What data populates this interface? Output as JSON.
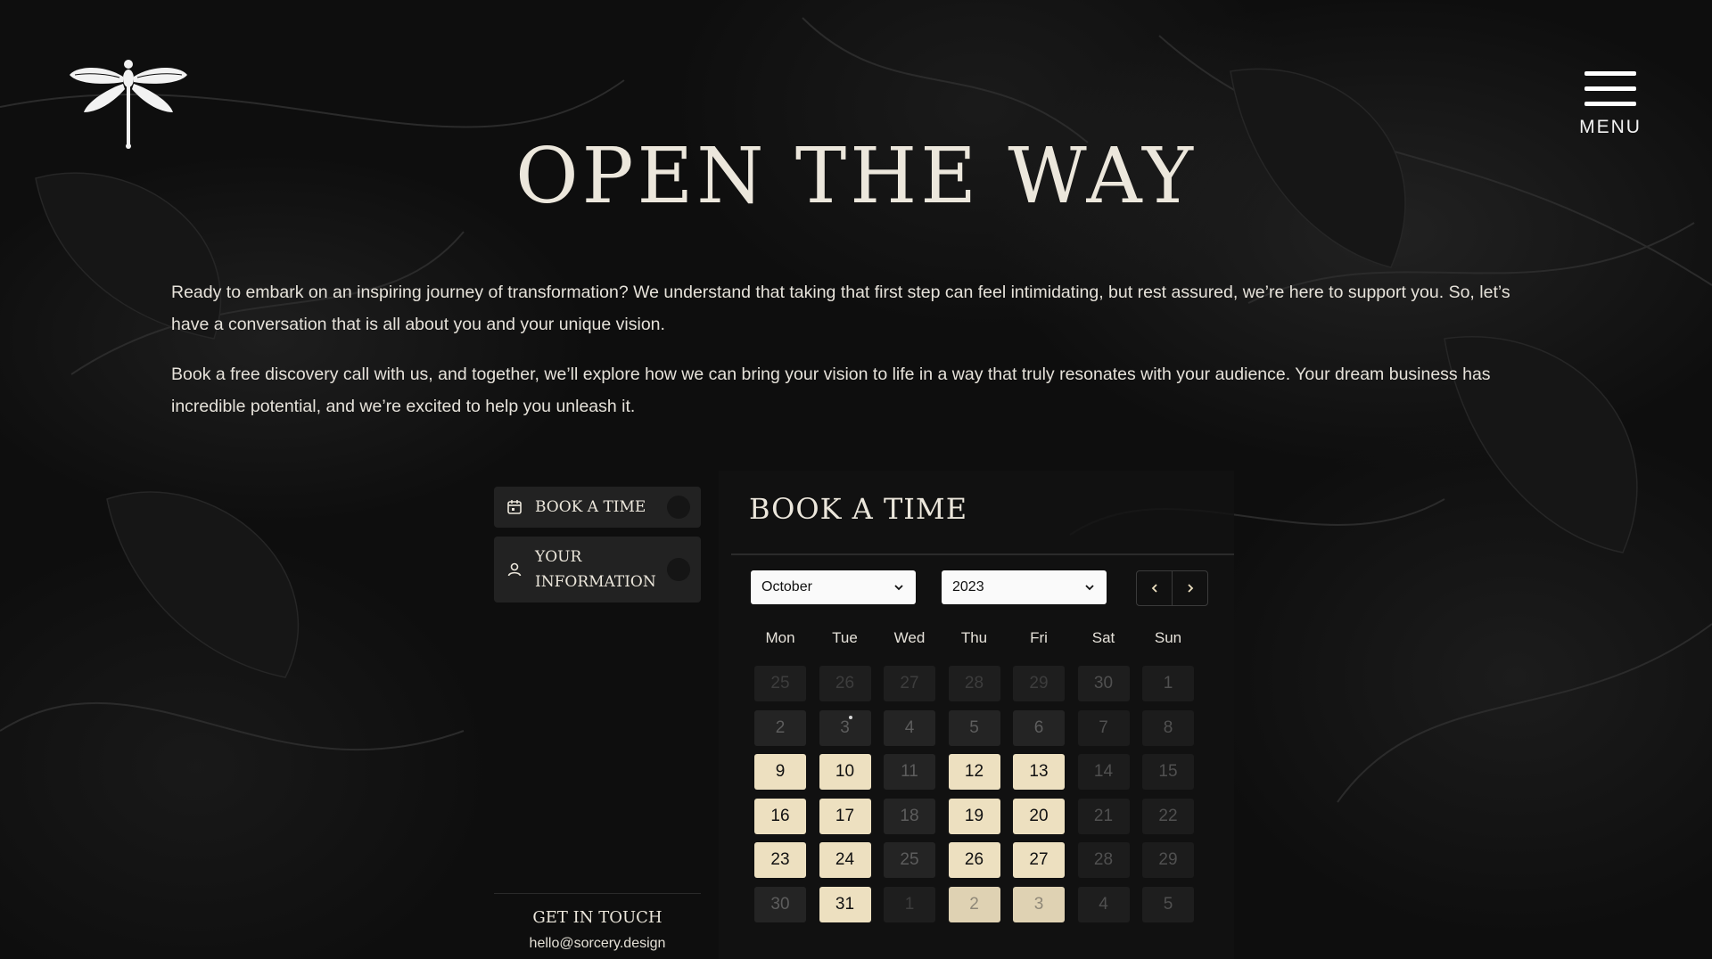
{
  "header": {
    "menu_label": "MENU",
    "logo_icon": "dragonfly-logo-icon"
  },
  "hero": {
    "title": "OPEN THE WAY",
    "paragraphs": [
      "Ready to embark on an inspiring journey of transformation? We understand that taking that first step can feel intimidating, but rest assured, we’re here to support you. So, let’s have a conversation that is all about you and your unique vision.",
      "Book a free discovery call with us, and together, we’ll explore how we can bring your vision to life in a way that truly resonates with your audience. Your dream business has incredible potential, and we’re excited to help you unleash it."
    ]
  },
  "booking": {
    "steps": [
      {
        "label": "BOOK A TIME",
        "icon": "calendar-icon"
      },
      {
        "label": "YOUR INFORMATION",
        "icon": "user-icon"
      }
    ],
    "contact": {
      "title": "GET IN TOUCH",
      "email": "hello@sorcery.design"
    },
    "panel_title": "BOOK A TIME",
    "month": "October",
    "year": "2023",
    "weekdays": [
      "Mon",
      "Tue",
      "Wed",
      "Thu",
      "Fri",
      "Sat",
      "Sun"
    ],
    "days": [
      {
        "n": "25",
        "state": "off",
        "other": true
      },
      {
        "n": "26",
        "state": "off",
        "other": true
      },
      {
        "n": "27",
        "state": "off",
        "other": true
      },
      {
        "n": "28",
        "state": "off",
        "other": true
      },
      {
        "n": "29",
        "state": "off",
        "other": true
      },
      {
        "n": "30",
        "state": "off",
        "other": true,
        "weekend": true
      },
      {
        "n": "1",
        "state": "off",
        "weekend": true
      },
      {
        "n": "2",
        "state": "off"
      },
      {
        "n": "3",
        "state": "off",
        "today": true
      },
      {
        "n": "4",
        "state": "off"
      },
      {
        "n": "5",
        "state": "off"
      },
      {
        "n": "6",
        "state": "off"
      },
      {
        "n": "7",
        "state": "off",
        "weekend": true
      },
      {
        "n": "8",
        "state": "off",
        "weekend": true
      },
      {
        "n": "9",
        "state": "avail"
      },
      {
        "n": "10",
        "state": "avail"
      },
      {
        "n": "11",
        "state": "off"
      },
      {
        "n": "12",
        "state": "avail"
      },
      {
        "n": "13",
        "state": "avail"
      },
      {
        "n": "14",
        "state": "off",
        "weekend": true
      },
      {
        "n": "15",
        "state": "off",
        "weekend": true
      },
      {
        "n": "16",
        "state": "avail"
      },
      {
        "n": "17",
        "state": "avail"
      },
      {
        "n": "18",
        "state": "off"
      },
      {
        "n": "19",
        "state": "avail"
      },
      {
        "n": "20",
        "state": "avail"
      },
      {
        "n": "21",
        "state": "off",
        "weekend": true
      },
      {
        "n": "22",
        "state": "off",
        "weekend": true
      },
      {
        "n": "23",
        "state": "avail"
      },
      {
        "n": "24",
        "state": "avail"
      },
      {
        "n": "25",
        "state": "off"
      },
      {
        "n": "26",
        "state": "avail"
      },
      {
        "n": "27",
        "state": "avail"
      },
      {
        "n": "28",
        "state": "off",
        "weekend": true
      },
      {
        "n": "29",
        "state": "off",
        "weekend": true
      },
      {
        "n": "30",
        "state": "off"
      },
      {
        "n": "31",
        "state": "avail"
      },
      {
        "n": "1",
        "state": "off",
        "other": true
      },
      {
        "n": "2",
        "state": "avail",
        "other": true
      },
      {
        "n": "3",
        "state": "avail",
        "other": true
      },
      {
        "n": "4",
        "state": "off",
        "other": true,
        "weekend": true
      },
      {
        "n": "5",
        "state": "off",
        "other": true,
        "weekend": true
      }
    ]
  },
  "colors": {
    "accent": "#ede0c0",
    "background": "#0e0e0e",
    "text": "#e8e3d6"
  }
}
